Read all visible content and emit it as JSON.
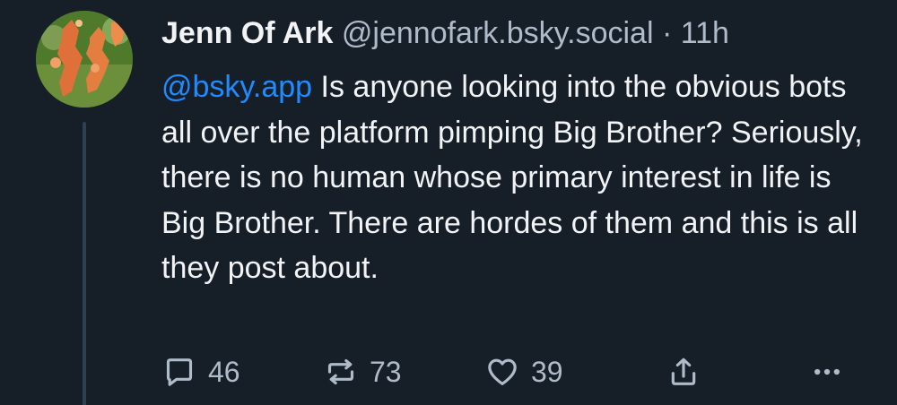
{
  "post": {
    "author": {
      "display_name": "Jenn Of Ark",
      "handle": "@jennofark.bsky.social",
      "avatar_icon": "avatar-image"
    },
    "separator": "·",
    "timestamp": "11h",
    "mention": "@bsky.app",
    "text": " Is anyone looking into the obvious bots all over the platform pimping Big Brother? Seriously, there is no human whose primary interest in life is Big Brother. There are hordes of them and this is all they post about.",
    "actions": {
      "reply": {
        "icon": "reply-icon",
        "count": "46"
      },
      "repost": {
        "icon": "repost-icon",
        "count": "73"
      },
      "like": {
        "icon": "heart-icon",
        "count": "39"
      },
      "share": {
        "icon": "share-icon"
      },
      "more": {
        "icon": "more-icon"
      }
    }
  },
  "colors": {
    "background": "#161e27",
    "text": "#f1f3f5",
    "muted": "#aebbc9",
    "link": "#208bfe",
    "thread_line": "#2e4052"
  }
}
